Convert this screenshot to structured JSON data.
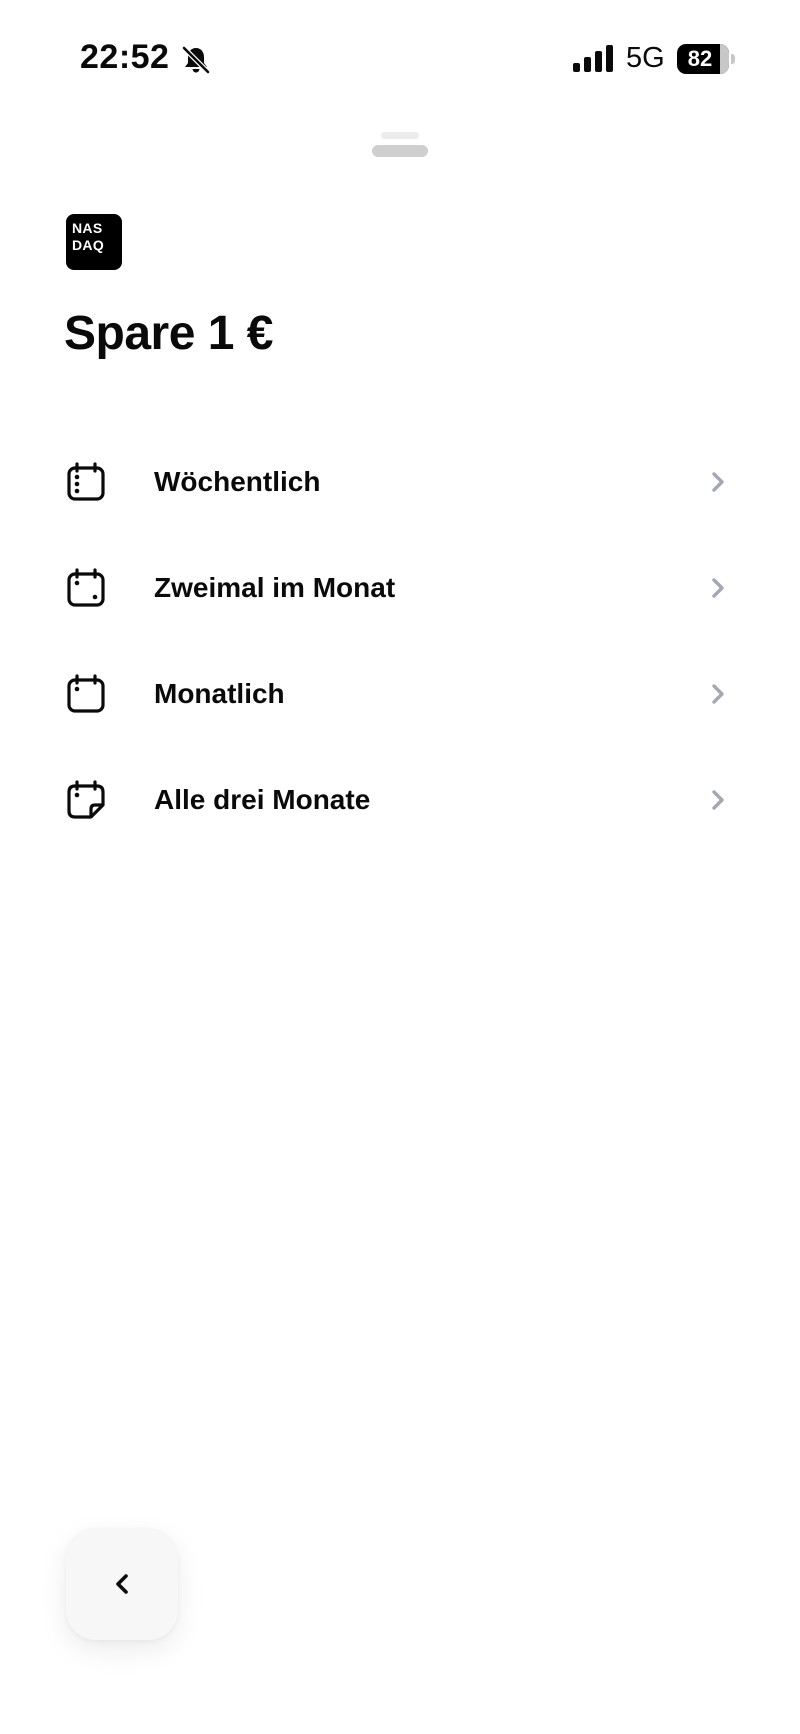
{
  "status_bar": {
    "time": "22:52",
    "silent_icon": "bell-slash-icon",
    "signal_icon": "cellular-signal-icon",
    "network": "5G",
    "battery_level": "82",
    "battery_fraction": 0.82
  },
  "sheet": {
    "logo": {
      "line1": "NAS",
      "line2": "DAQ"
    },
    "title": "Spare 1 €",
    "options": [
      {
        "label": "Wöchentlich",
        "icon": "calendar-weekly-icon"
      },
      {
        "label": "Zweimal im Monat",
        "icon": "calendar-twice-monthly-icon"
      },
      {
        "label": "Monatlich",
        "icon": "calendar-monthly-icon"
      },
      {
        "label": "Alle drei Monate",
        "icon": "calendar-quarterly-icon"
      }
    ],
    "back_icon": "chevron-left-icon"
  },
  "colors": {
    "text": "#0a0a0a",
    "chevron": "#a3a8b3",
    "handle": "#cfcfcf",
    "back_button_bg": "#f7f7f7"
  }
}
